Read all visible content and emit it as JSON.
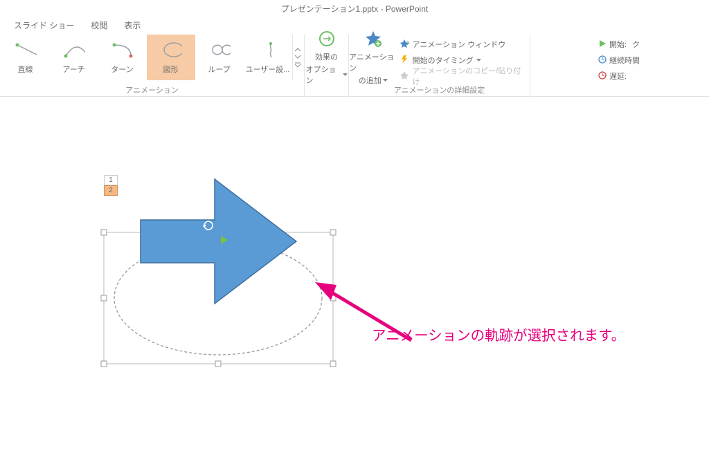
{
  "titleBar": {
    "title": "プレゼンテーション1.pptx - PowerPoint"
  },
  "tabs": {
    "slideshow": "スライド ショー",
    "review": "校閲",
    "view": "表示"
  },
  "ribbon": {
    "animGalleryLabel": "アニメーション",
    "items": {
      "line": "直線",
      "arch": "アーチ",
      "turn": "ターン",
      "shape": "図形",
      "loop": "ループ",
      "userPath": "ユーザー設..."
    },
    "effectOptions": {
      "line1": "効果の",
      "line2": "オプション"
    },
    "addAnim": {
      "line1": "アニメーション",
      "line2": "の追加"
    },
    "advanced": {
      "pane": "アニメーション ウィンドウ",
      "timing": "開始のタイミング",
      "painter": "アニメーションのコピー/貼り付け",
      "groupLabel": "アニメーションの詳細設定"
    },
    "timing": {
      "start": "開始:",
      "startValue": "ク",
      "duration": "継続時間",
      "delay": "遅延:"
    }
  },
  "canvas": {
    "animOrder1": "1",
    "animOrder2": "2",
    "annotation": "アニメーションの軌跡が選択されます。"
  }
}
